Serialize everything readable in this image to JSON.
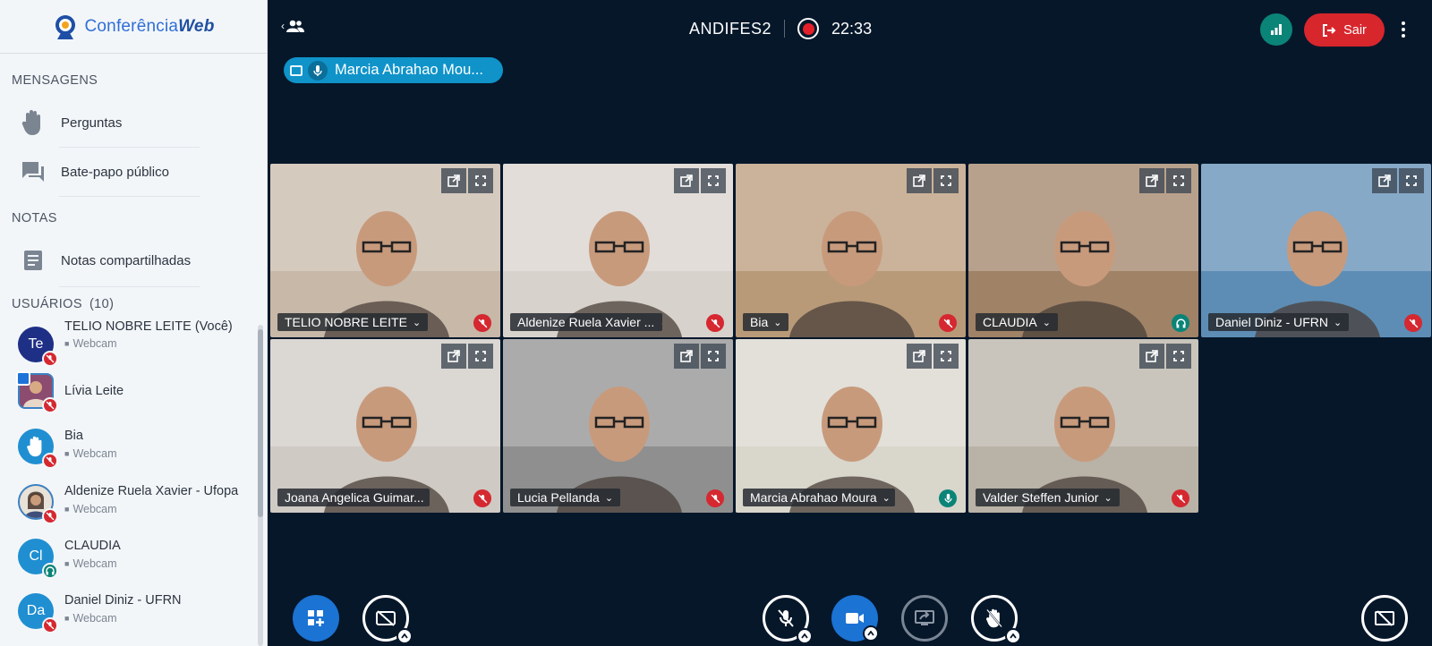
{
  "app": {
    "logo_text": "ConferênciaWeb",
    "meeting_title": "ANDIFES2",
    "timer": "22:33",
    "leave_label": "Sair"
  },
  "sidebar": {
    "messages_title": "MENSAGENS",
    "messages_items": [
      {
        "label": "Perguntas",
        "icon": "raised-hand-icon"
      },
      {
        "label": "Bate-papo público",
        "icon": "chat-icon"
      }
    ],
    "notes_title": "NOTAS",
    "notes_items": [
      {
        "label": "Notas compartilhadas",
        "icon": "document-icon"
      }
    ],
    "users_title": "USUÁRIOS",
    "users_count": "(10)",
    "users": [
      {
        "name": "TELIO NOBRE LEITE (Você)",
        "sub": "Webcam",
        "avatar": "Te",
        "color": "#1e2f86",
        "status": "muted"
      },
      {
        "name": "Lívia Leite",
        "sub": "",
        "avatar": "",
        "color": "#7a3f64",
        "status": "muted"
      },
      {
        "name": "Bia",
        "sub": "Webcam",
        "avatar": "hand",
        "color": "#1f8fd1",
        "status": "muted"
      },
      {
        "name": "Aldenize Ruela Xavier - Ufopa",
        "sub": "Webcam",
        "avatar": "",
        "color": "#c2a083",
        "status": "muted"
      },
      {
        "name": "CLAUDIA",
        "sub": "Webcam",
        "avatar": "Cl",
        "color": "#1f8fd1",
        "status": "listen"
      },
      {
        "name": "Daniel Diniz - UFRN",
        "sub": "Webcam",
        "avatar": "Da",
        "color": "#1f8fd1",
        "status": "muted"
      }
    ]
  },
  "talking_indicator": {
    "name": "Marcia Abrahao Mou..."
  },
  "videos": [
    {
      "name": "TELIO NOBRE LEITE",
      "state": "muted",
      "scene": "#c7b8a8"
    },
    {
      "name": "Aldenize Ruela Xavier ...",
      "state": "muted",
      "scene": "#d8d2cc"
    },
    {
      "name": "Bia",
      "state": "muted",
      "scene": "#b89a78"
    },
    {
      "name": "CLAUDIA",
      "state": "listen",
      "scene": "#a08266"
    },
    {
      "name": "Daniel Diniz - UFRN",
      "state": "muted",
      "scene": "#5d8db5"
    },
    {
      "name": "Joana Angelica Guimar...",
      "state": "muted",
      "scene": "#cfcac4"
    },
    {
      "name": "Lucia Pellanda",
      "state": "muted",
      "scene": "#8f8f8f"
    },
    {
      "name": "Marcia Abrahao Moura",
      "state": "talking",
      "scene": "#d9d6cc"
    },
    {
      "name": "Valder Steffen Junior",
      "state": "muted",
      "scene": "#b9b2a6"
    }
  ]
}
